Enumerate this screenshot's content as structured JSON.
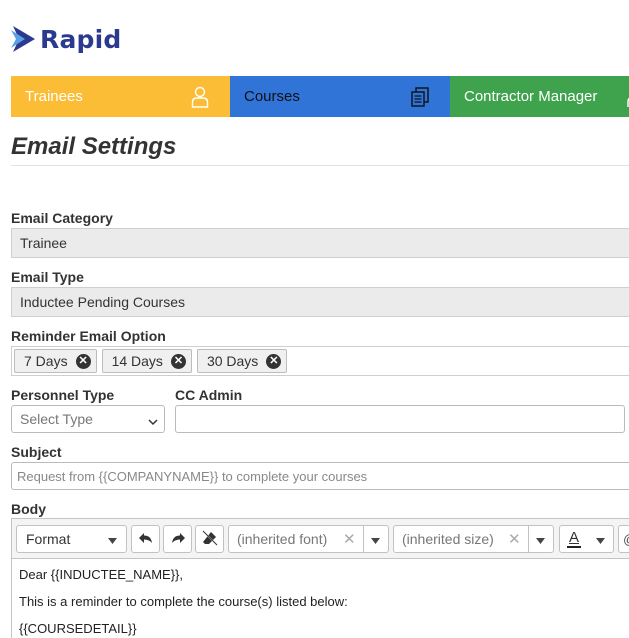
{
  "brand": {
    "name": "Rapid"
  },
  "nav": {
    "tabs": [
      {
        "label": "Trainees",
        "icon": "user-icon",
        "color": "#fbbd35"
      },
      {
        "label": "Courses",
        "icon": "documents-icon",
        "color": "#2f74d6"
      },
      {
        "label": "Contractor Manager",
        "icon": "user-icon",
        "color": "#3fa34d"
      }
    ]
  },
  "page": {
    "title": "Email Settings"
  },
  "form": {
    "email_category": {
      "label": "Email Category",
      "value": "Trainee"
    },
    "email_type": {
      "label": "Email Type",
      "value": "Inductee Pending Courses"
    },
    "reminder": {
      "label": "Reminder Email Option",
      "tags": [
        "7 Days",
        "14 Days",
        "30 Days"
      ]
    },
    "personnel_type": {
      "label": "Personnel Type",
      "value": "Select Type"
    },
    "cc_admin": {
      "label": "CC Admin",
      "value": ""
    },
    "subject": {
      "label": "Subject",
      "value": "Request from {{COMPANYNAME}} to complete your courses"
    },
    "body": {
      "label": "Body",
      "toolbar": {
        "format": "Format",
        "font": "(inherited font)",
        "size": "(inherited size)",
        "text_color_glyph": "A"
      },
      "lines": [
        "Dear {{INDUCTEE_NAME}},",
        "This is a reminder to complete the course(s) listed below:",
        "{{COURSEDETAIL}}"
      ]
    }
  }
}
